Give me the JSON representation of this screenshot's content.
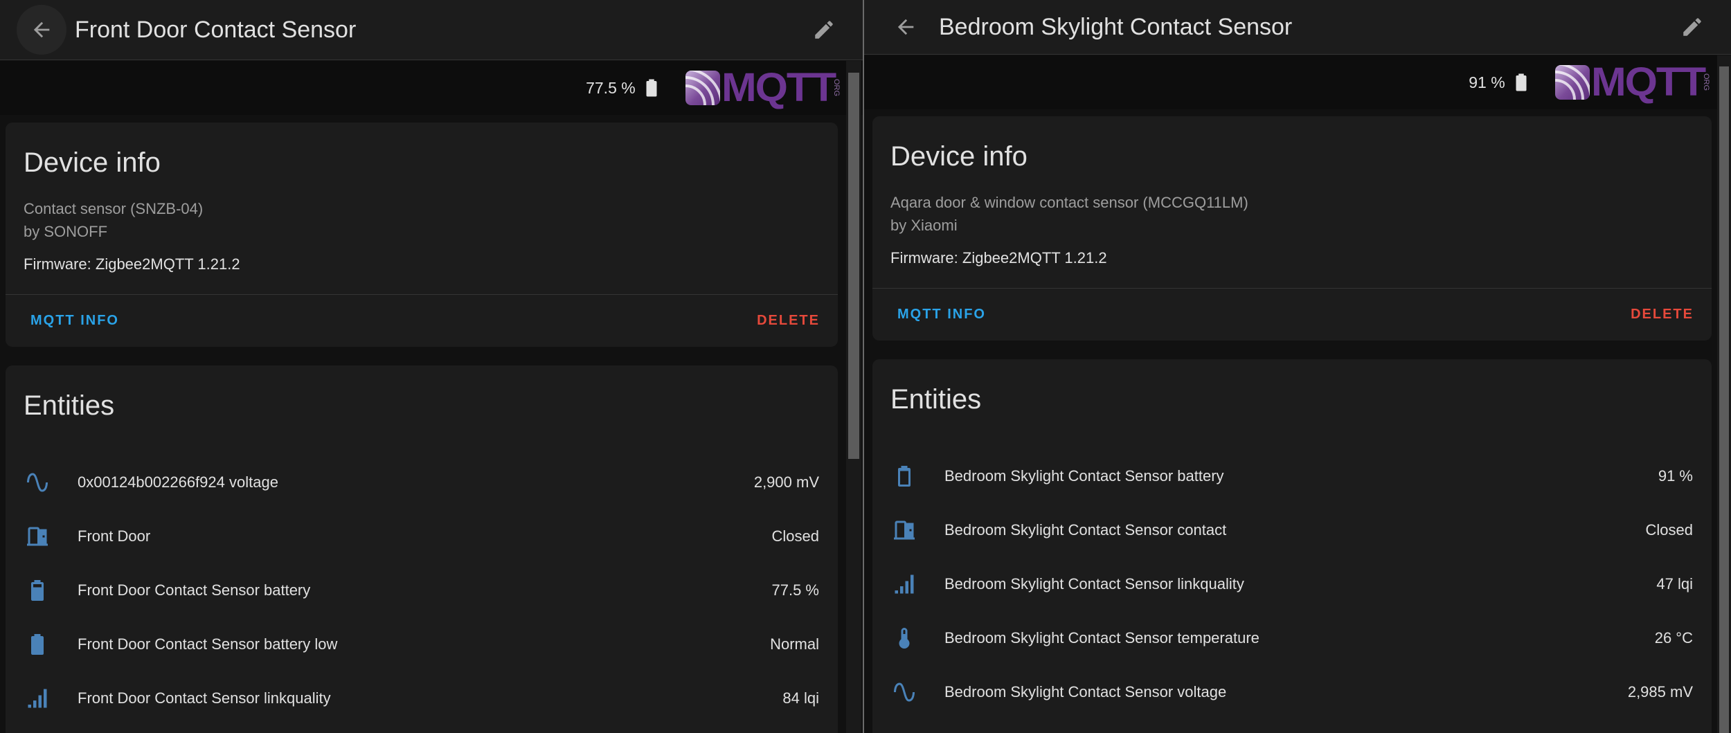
{
  "panes": {
    "left": {
      "title": "Front Door Contact Sensor",
      "battery": "77.5 %",
      "device_info": {
        "heading": "Device info",
        "model": "Contact sensor (SNZB-04)",
        "manufacturer": "by SONOFF",
        "firmware": "Firmware: Zigbee2MQTT 1.21.2",
        "mqtt_info": "MQTT INFO",
        "delete": "DELETE"
      },
      "entities": {
        "heading": "Entities",
        "rows": [
          {
            "icon": "sine-wave-icon",
            "name": "0x00124b002266f924 voltage",
            "state": "2,900 mV"
          },
          {
            "icon": "door-icon",
            "name": "Front Door",
            "state": "Closed"
          },
          {
            "icon": "battery-icon",
            "name": "Front Door Contact Sensor battery",
            "state": "77.5 %"
          },
          {
            "icon": "battery-full-icon",
            "name": "Front Door Contact Sensor battery low",
            "state": "Normal"
          },
          {
            "icon": "signal-icon",
            "name": "Front Door Contact Sensor linkquality",
            "state": "84 lqi"
          }
        ]
      }
    },
    "right": {
      "title": "Bedroom Skylight Contact Sensor",
      "battery": "91 %",
      "device_info": {
        "heading": "Device info",
        "model": "Aqara door & window contact sensor (MCCGQ11LM)",
        "manufacturer": "by Xiaomi",
        "firmware": "Firmware: Zigbee2MQTT 1.21.2",
        "mqtt_info": "MQTT INFO",
        "delete": "DELETE"
      },
      "entities": {
        "heading": "Entities",
        "rows": [
          {
            "icon": "battery-icon",
            "name": "Bedroom Skylight Contact Sensor battery",
            "state": "91 %"
          },
          {
            "icon": "door-icon",
            "name": "Bedroom Skylight Contact Sensor contact",
            "state": "Closed"
          },
          {
            "icon": "signal-icon",
            "name": "Bedroom Skylight Contact Sensor linkquality",
            "state": "47 lqi"
          },
          {
            "icon": "thermometer-icon",
            "name": "Bedroom Skylight Contact Sensor temperature",
            "state": "26 °C"
          },
          {
            "icon": "sine-wave-icon",
            "name": "Bedroom Skylight Contact Sensor voltage",
            "state": "2,985 mV"
          }
        ]
      }
    }
  },
  "logo": {
    "text": "MQTT",
    "suffix": "ORG"
  },
  "colors": {
    "background": "#111111",
    "card": "#1c1c1c",
    "primary_text": "#e1e1e1",
    "secondary_text": "#9e9e9e",
    "accent_blue": "#2aa3e8",
    "delete_red": "#e6493b",
    "entity_icon": "#4a82b8",
    "mqtt_purple": "#6c3591"
  }
}
